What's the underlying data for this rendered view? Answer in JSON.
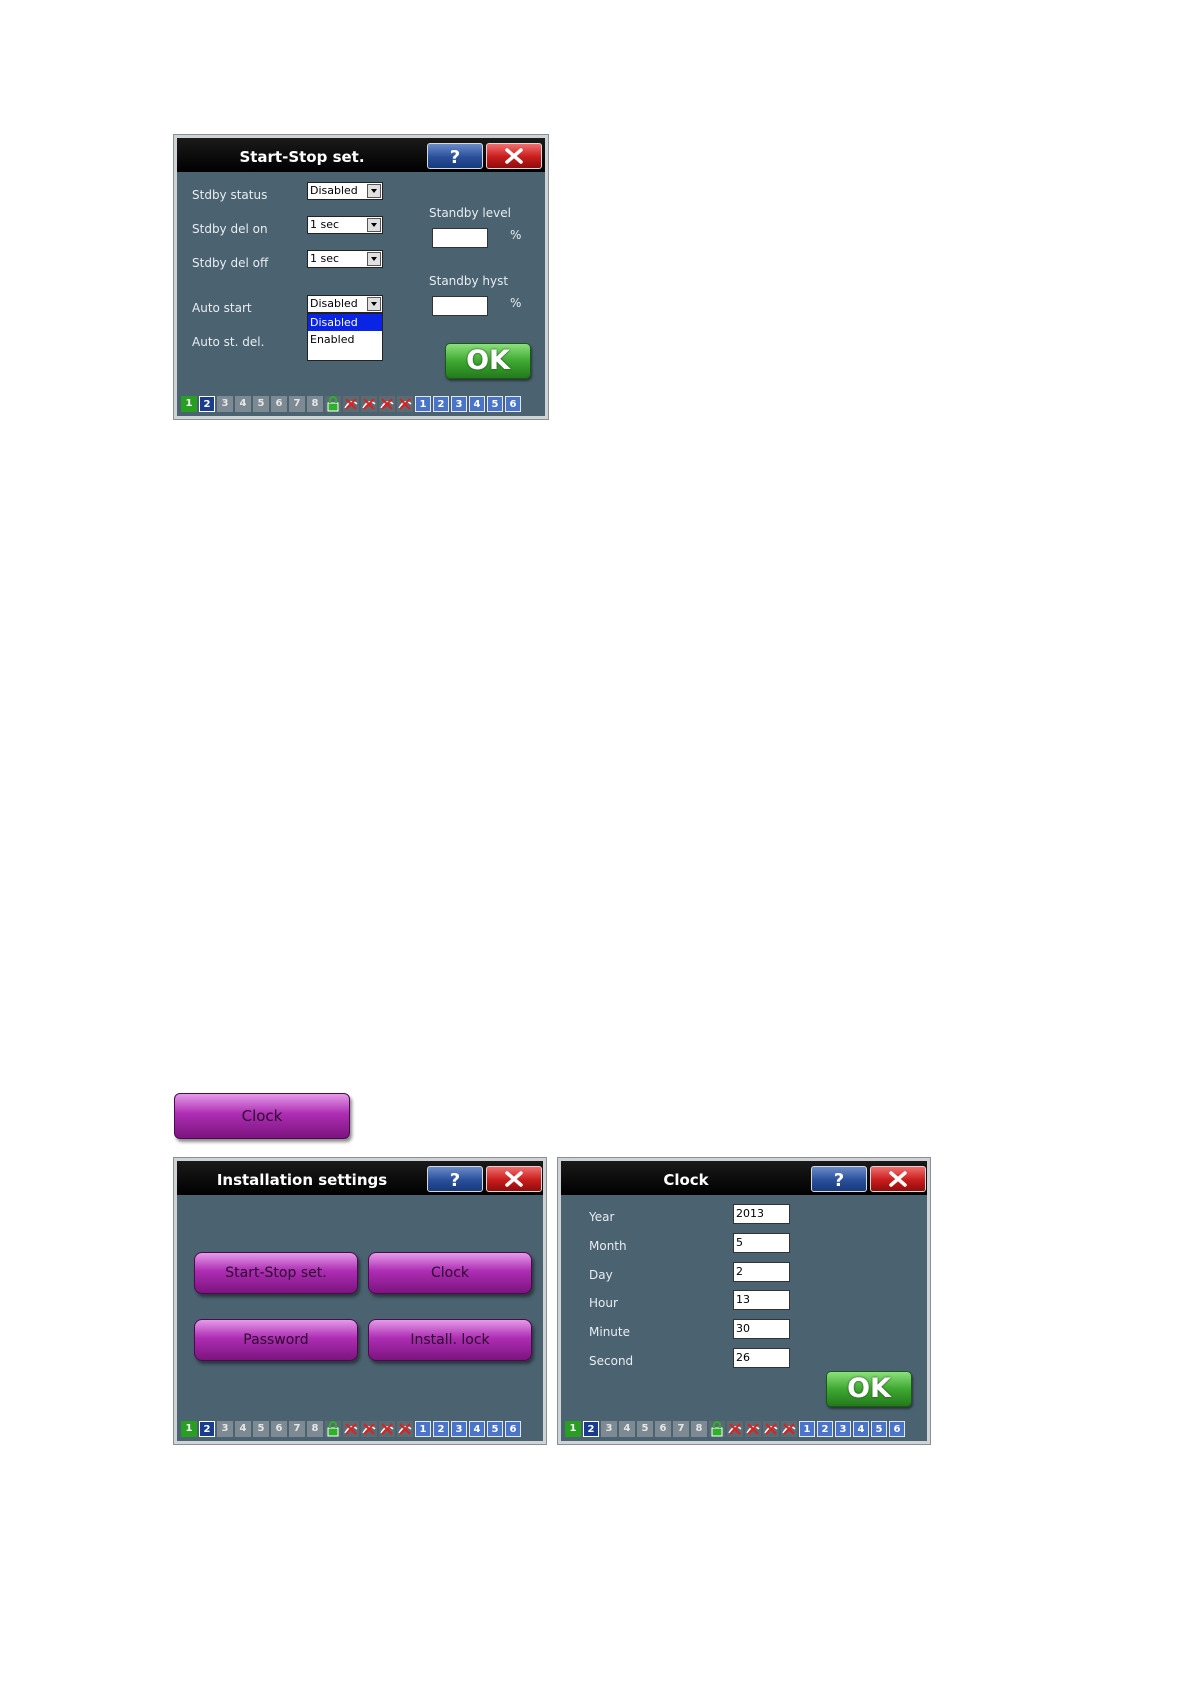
{
  "colors": {
    "window_bg": "#4b6270",
    "title_bg": "#000000",
    "help_button": "#2a4f9a",
    "close_button": "#c81c1c",
    "ok_button": "#3fa832",
    "purple_button": "#ad2db3",
    "dropdown_selected": "#0a24e6"
  },
  "start_stop": {
    "title": "Start-Stop set.",
    "help_icon": "question-mark-icon",
    "close_icon": "close-x-icon",
    "stdby_status": {
      "label": "Stdby status",
      "value": "Disabled"
    },
    "stdby_del_on": {
      "label": "Stdby del on",
      "value": "1 sec"
    },
    "stdby_del_off": {
      "label": "Stdby del off",
      "value": "1 sec"
    },
    "auto_start": {
      "label": "Auto start",
      "value": "Disabled",
      "options": [
        {
          "label": "Disabled",
          "selected": true
        },
        {
          "label": "Enabled",
          "selected": false
        }
      ]
    },
    "auto_st_del": {
      "label": "Auto st. del."
    },
    "standby_level": {
      "label": "Standby level",
      "value": "",
      "unit": "%"
    },
    "standby_hyst": {
      "label": "Standby hyst",
      "value": "",
      "unit": "%"
    },
    "ok_label": "OK"
  },
  "clock_button": {
    "label": "Clock"
  },
  "installation": {
    "title": "Installation settings",
    "buttons": {
      "start_stop": "Start-Stop set.",
      "clock": "Clock",
      "password": "Password",
      "install_lock": "Install. lock"
    }
  },
  "clock": {
    "title": "Clock",
    "fields": {
      "year": {
        "label": "Year",
        "value": "2013"
      },
      "month": {
        "label": "Month",
        "value": "5"
      },
      "day": {
        "label": "Day",
        "value": "2"
      },
      "hour": {
        "label": "Hour",
        "value": "13"
      },
      "minute": {
        "label": "Minute",
        "value": "30"
      },
      "second": {
        "label": "Second",
        "value": "26"
      }
    },
    "ok_label": "OK"
  },
  "status_bar": {
    "items": [
      "1",
      "2",
      "3",
      "4",
      "5",
      "6",
      "7",
      "8",
      "",
      "",
      "",
      "",
      "",
      "1",
      "2",
      "3",
      "4",
      "5",
      "6"
    ],
    "styles": [
      "green",
      "navy",
      "gray",
      "gray",
      "gray",
      "gray",
      "gray",
      "gray",
      "ico",
      "ico",
      "ico",
      "ico",
      "ico",
      "blue",
      "blue",
      "blue",
      "blue",
      "blue",
      "blue"
    ],
    "icons": [
      "",
      "",
      "",
      "",
      "",
      "",
      "",
      "",
      "lock-icon",
      "crossed-wire-icon",
      "crossed-wire-icon",
      "crossed-wire-icon",
      "crossed-wire-icon",
      "",
      "",
      "",
      "",
      "",
      ""
    ]
  }
}
